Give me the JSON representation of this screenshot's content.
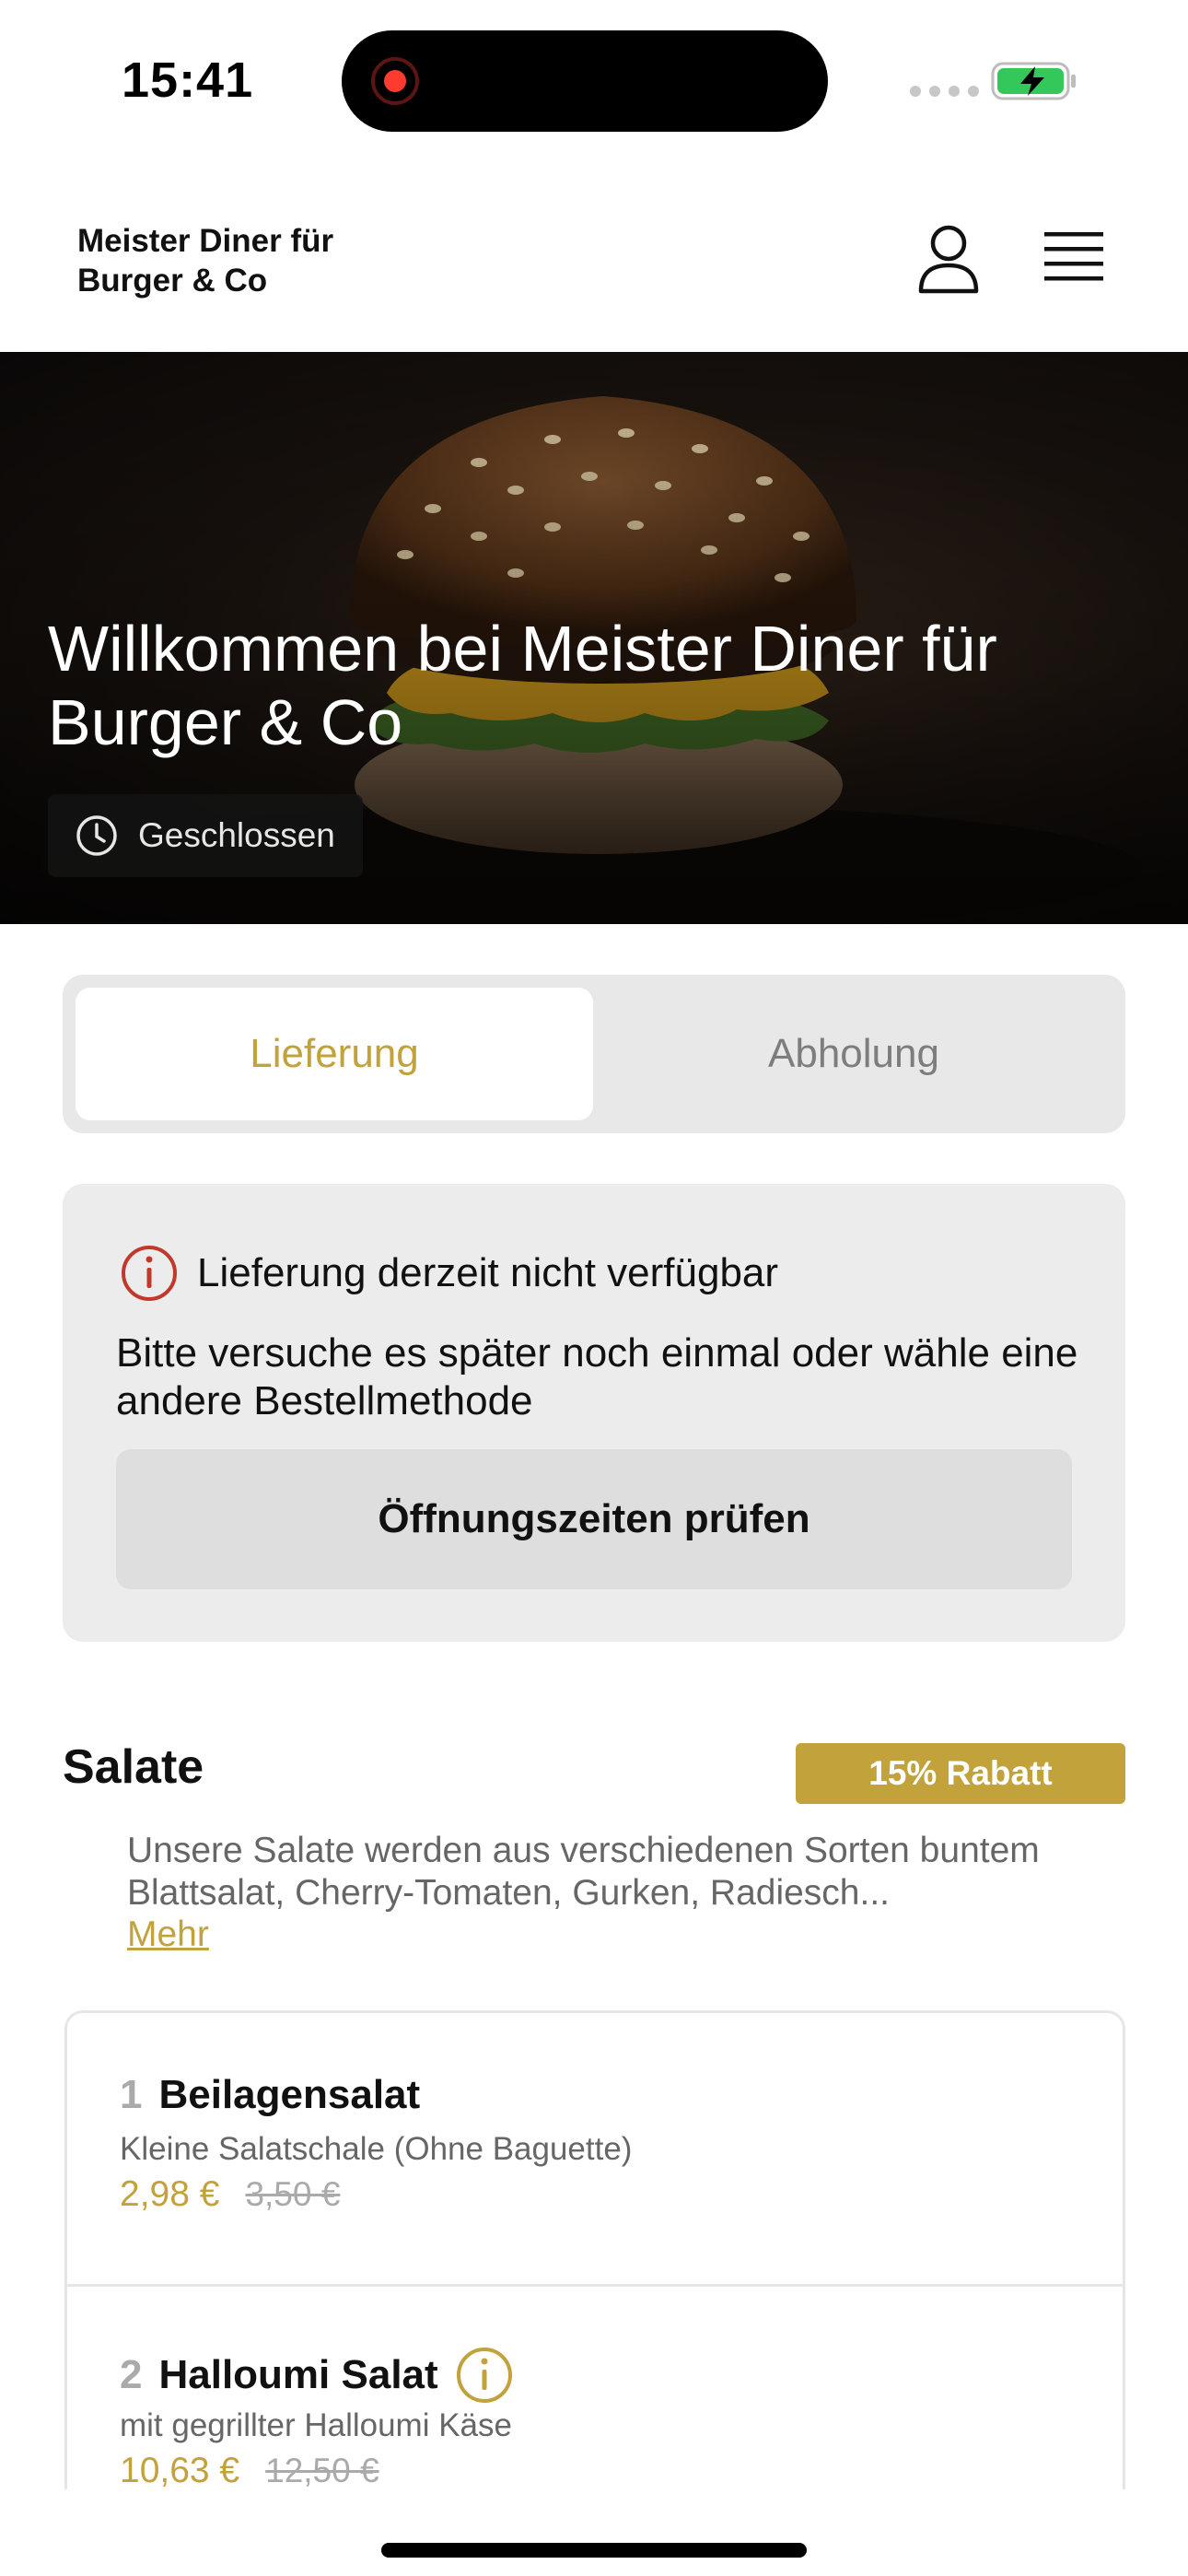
{
  "status_bar": {
    "time": "15:41"
  },
  "header": {
    "brand": "Meister Diner für Burger & Co",
    "user_icon": "user-icon",
    "menu_icon": "hamburger-menu-icon"
  },
  "hero": {
    "title": "Willkommen bei Meister Diner für Burger & Co",
    "status": "Geschlossen",
    "status_icon": "clock-icon"
  },
  "tabs": [
    {
      "label": "Lieferung",
      "active": true
    },
    {
      "label": "Abholung",
      "active": false
    }
  ],
  "notice": {
    "icon": "info-icon",
    "title": "Lieferung derzeit nicht verfügbar",
    "text": "Bitte versuche es später noch einmal oder wähle eine andere Bestellmethode",
    "button": "Öffnungszeiten prüfen"
  },
  "section": {
    "title": "Salate",
    "badge": "15% Rabatt",
    "description": "Unsere Salate werden aus verschiedenen Sorten buntem Blattsalat, Cherry-Tomaten, Gurken, Radiesch...",
    "more": "Mehr"
  },
  "items": [
    {
      "number": "1",
      "name": "Beilagensalat",
      "description": "Kleine Salatschale (Ohne Baguette)",
      "price": "2,98 €",
      "old_price": "3,50 €",
      "has_info": false
    },
    {
      "number": "2",
      "name": "Halloumi Salat",
      "description": "mit gegrillter Halloumi Käse",
      "price": "10,63 €",
      "old_price": "12,50 €",
      "has_info": true
    }
  ],
  "colors": {
    "accent": "#c2a23b",
    "alert": "#c0392b"
  }
}
